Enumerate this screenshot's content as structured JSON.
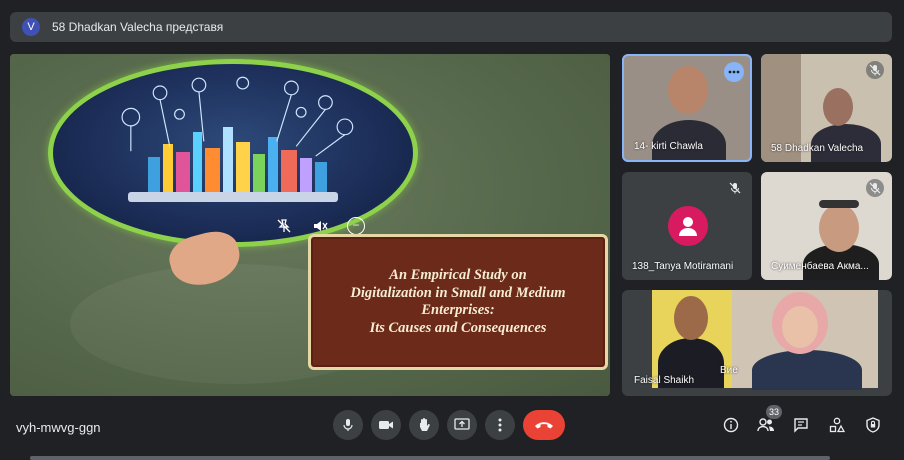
{
  "presenter_bar": {
    "avatar_letter": "V",
    "text": "58 Dhadkan Valecha представя"
  },
  "slide": {
    "title_lines": [
      "An Empirical Study on",
      "Digitalization in Small and Medium",
      "Enterprises:",
      "Its Causes and Consequences"
    ],
    "colors": {
      "box_bg": "#6b2a1a",
      "box_border": "#e8d7a6",
      "oval_border": "#8dd24a"
    }
  },
  "participants": [
    {
      "name": "14- kirti Chawla",
      "muted": false,
      "active": true
    },
    {
      "name": "58 Dhadkan Valecha",
      "muted": true
    },
    {
      "name": "138_Tanya Motiramani",
      "muted": true,
      "avatar": "person-icon"
    },
    {
      "name": "Суименбаева Акма...",
      "muted": true
    },
    {
      "name": "Faisal Shaikh",
      "muted": false
    },
    {
      "name": "Вие",
      "muted": false
    }
  ],
  "bottom": {
    "meeting_code": "vyh-mwvg-ggn",
    "people_count": "33",
    "controls": [
      "mic-icon",
      "camera-icon",
      "raise-hand-icon",
      "present-icon",
      "more-options-icon",
      "end-call-icon"
    ],
    "side_controls": [
      "info-icon",
      "people-icon",
      "chat-icon",
      "activities-icon",
      "host-controls-icon"
    ]
  }
}
